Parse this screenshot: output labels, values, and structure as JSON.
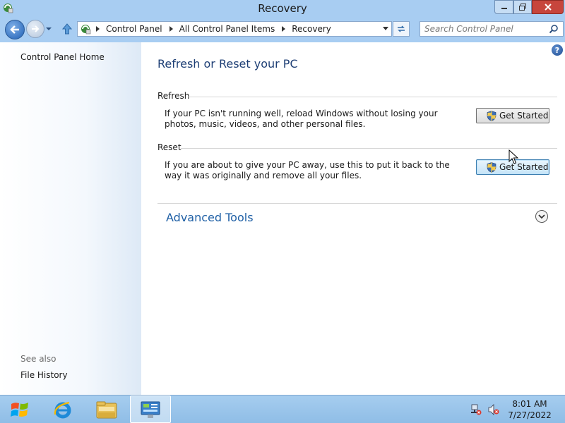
{
  "window": {
    "title": "Recovery"
  },
  "navigation": {
    "breadcrumbs": [
      "Control Panel",
      "All Control Panel Items",
      "Recovery"
    ],
    "search_placeholder": "Search Control Panel"
  },
  "sidebar": {
    "home_link": "Control Panel Home",
    "see_also_label": "See also",
    "see_also_links": [
      "File History"
    ]
  },
  "main": {
    "page_title": "Refresh or Reset your PC",
    "refresh": {
      "heading": "Refresh",
      "description": "If your PC isn't running well, reload Windows without losing your photos, music, videos, and other personal files.",
      "button_label": "Get Started"
    },
    "reset": {
      "heading": "Reset",
      "description": "If you are about to give your PC away, use this to put it back to the way it was originally and remove all your files.",
      "button_label": "Get Started"
    },
    "advanced_tools_label": "Advanced Tools"
  },
  "taskbar": {
    "apps": [
      "internet-explorer-icon",
      "file-explorer-icon",
      "control-panel-icon"
    ],
    "active_app": "control-panel-icon",
    "clock_time": "8:01 AM",
    "clock_date": "7/27/2022"
  },
  "colors": {
    "title_blue": "#1e3f75",
    "link_blue": "#1e5fa5",
    "chrome_blue": "#a8cdf2",
    "close_red": "#c7453c"
  }
}
